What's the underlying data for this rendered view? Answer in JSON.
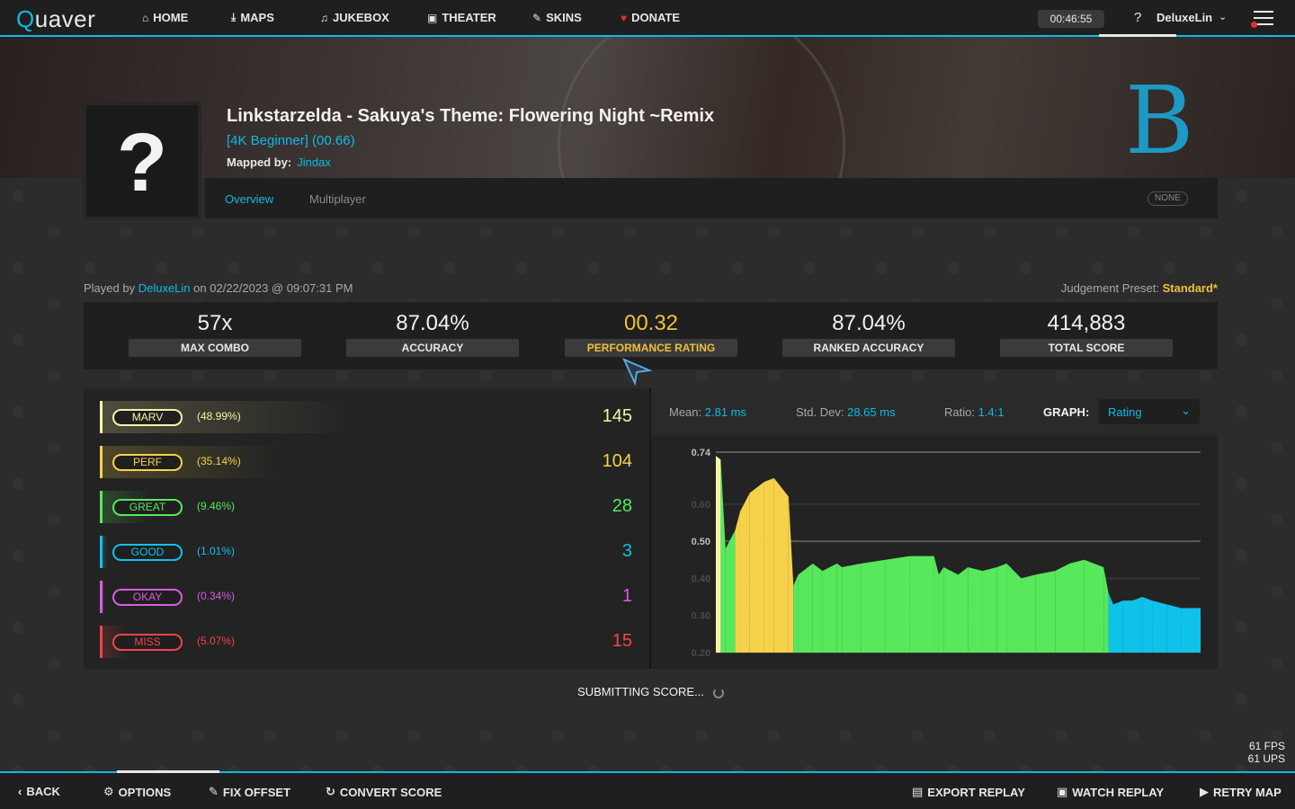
{
  "app": {
    "name": "Quaver"
  },
  "topnav": {
    "items": [
      {
        "label": "HOME",
        "icon": "home-icon"
      },
      {
        "label": "MAPS",
        "icon": "download-icon"
      },
      {
        "label": "JUKEBOX",
        "icon": "music-icon"
      },
      {
        "label": "THEATER",
        "icon": "camera-icon"
      },
      {
        "label": "SKINS",
        "icon": "brush-icon"
      },
      {
        "label": "DONATE",
        "icon": "heart-icon"
      }
    ],
    "clock": "00:46:55",
    "help": "?",
    "username": "DeluxeLin"
  },
  "map": {
    "title": "Linkstarzelda - Sakuya's Theme: Flowering Night ~Remix",
    "difficulty": "[4K Beginner] (00.66)",
    "mapped_by_label": "Mapped by:",
    "mapper": "Jindax",
    "cover_placeholder": "?",
    "grade": "B"
  },
  "tabs": {
    "overview": "Overview",
    "multiplayer": "Multiplayer",
    "mods": "NONE"
  },
  "played": {
    "prefix": "Played by",
    "player": "DeluxeLin",
    "suffix": "on 02/22/2023 @ 09:07:31 PM"
  },
  "judgement_preset": {
    "label": "Judgement Preset:",
    "value": "Standard*"
  },
  "stats": {
    "max_combo": {
      "value": "57x",
      "label": "MAX COMBO"
    },
    "accuracy": {
      "value": "87.04%",
      "label": "ACCURACY"
    },
    "performance": {
      "value": "00.32",
      "label": "PERFORMANCE RATING"
    },
    "ranked_accuracy": {
      "value": "87.04%",
      "label": "RANKED ACCURACY"
    },
    "total_score": {
      "value": "414,883",
      "label": "TOTAL SCORE"
    }
  },
  "judgements": [
    {
      "name": "MARV",
      "pct": "(48.99%)",
      "count": "145",
      "color": "#f7f3a6"
    },
    {
      "name": "PERF",
      "pct": "(35.14%)",
      "count": "104",
      "color": "#f5d24a"
    },
    {
      "name": "GREAT",
      "pct": "(9.46%)",
      "count": "28",
      "color": "#57e85c"
    },
    {
      "name": "GOOD",
      "pct": "(1.01%)",
      "count": "3",
      "color": "#10c2ea"
    },
    {
      "name": "OKAY",
      "pct": "(0.34%)",
      "count": "1",
      "color": "#d75ee0"
    },
    {
      "name": "MISS",
      "pct": "(5.07%)",
      "count": "15",
      "color": "#f0444c"
    }
  ],
  "graph_header": {
    "mean_label": "Mean:",
    "mean": "2.81 ms",
    "stddev_label": "Std. Dev:",
    "stddev": "28.65 ms",
    "ratio_label": "Ratio:",
    "ratio": "1.4:1",
    "graph_label": "GRAPH:",
    "graph_value": "Rating"
  },
  "chart_data": {
    "type": "area",
    "y_ticks": [
      "0.74",
      "0.60",
      "0.50",
      "0.40",
      "0.30",
      "0.20"
    ],
    "ylim": [
      0.2,
      0.74
    ],
    "x": [
      0,
      0.01,
      0.02,
      0.04,
      0.05,
      0.07,
      0.1,
      0.12,
      0.15,
      0.16,
      0.17,
      0.2,
      0.22,
      0.25,
      0.26,
      0.3,
      0.35,
      0.4,
      0.45,
      0.46,
      0.47,
      0.5,
      0.52,
      0.55,
      0.58,
      0.6,
      0.63,
      0.66,
      0.7,
      0.73,
      0.76,
      0.8,
      0.81,
      0.82,
      0.84,
      0.86,
      0.88,
      0.9,
      0.93,
      0.96,
      1.0
    ],
    "values": [
      0.73,
      0.72,
      0.48,
      0.53,
      0.58,
      0.63,
      0.66,
      0.67,
      0.62,
      0.38,
      0.41,
      0.44,
      0.42,
      0.44,
      0.43,
      0.44,
      0.45,
      0.46,
      0.46,
      0.41,
      0.43,
      0.41,
      0.43,
      0.42,
      0.43,
      0.44,
      0.4,
      0.41,
      0.42,
      0.44,
      0.45,
      0.43,
      0.36,
      0.33,
      0.34,
      0.34,
      0.35,
      0.34,
      0.33,
      0.32,
      0.32
    ],
    "segment_colors": [
      {
        "until": 0.01,
        "color": "#f7f3a6"
      },
      {
        "until": 0.04,
        "color": "#57e85c"
      },
      {
        "until": 0.16,
        "color": "#f5d24a"
      },
      {
        "until": 0.81,
        "color": "#57e85c"
      },
      {
        "until": 1.0,
        "color": "#10c2ea"
      }
    ]
  },
  "submit": "SUBMITTING SCORE...",
  "fps": {
    "fps": "61 FPS",
    "ups": "61 UPS"
  },
  "bottomnav": {
    "back": "BACK",
    "options": "OPTIONS",
    "fix_offset": "FIX OFFSET",
    "convert_score": "CONVERT SCORE",
    "export_replay": "EXPORT REPLAY",
    "watch_replay": "WATCH REPLAY",
    "retry_map": "RETRY MAP"
  }
}
